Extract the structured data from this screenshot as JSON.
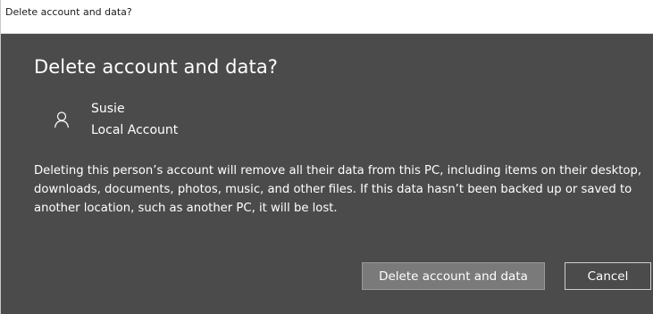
{
  "window": {
    "title": "Delete account and data?"
  },
  "dialog": {
    "heading": "Delete account and data?",
    "account": {
      "icon": "person-icon",
      "name": "Susie",
      "type": "Local Account"
    },
    "message": "Deleting this person’s account will remove all their data from this PC, including items on their desktop, downloads, documents, photos, music, and other files. If this data hasn’t been backed up or saved to another location, such as another PC, it will be lost.",
    "buttons": {
      "delete_label": "Delete account and data",
      "cancel_label": "Cancel"
    }
  },
  "colors": {
    "dialog_background": "#4b4b4b",
    "titlebar_background": "#ffffff",
    "primary_button": "#7a7a7a",
    "text": "#ffffff"
  }
}
